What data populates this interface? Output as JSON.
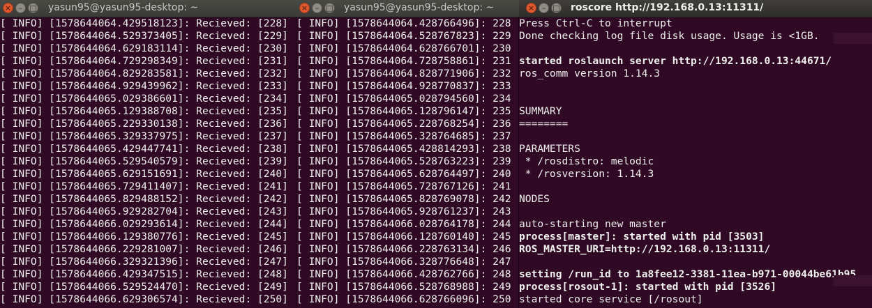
{
  "windows": [
    {
      "title": "yasun95@yasun95-desktop: ~",
      "lines": [
        "[ INFO] [1578644064.429518123]: Recieved: [228]",
        "[ INFO] [1578644064.529373405]: Recieved: [229]",
        "[ INFO] [1578644064.629183114]: Recieved: [230]",
        "[ INFO] [1578644064.729298349]: Recieved: [231]",
        "[ INFO] [1578644064.829283581]: Recieved: [232]",
        "[ INFO] [1578644064.929439962]: Recieved: [233]",
        "[ INFO] [1578644065.029386601]: Recieved: [234]",
        "[ INFO] [1578644065.129388708]: Recieved: [235]",
        "[ INFO] [1578644065.229330138]: Recieved: [236]",
        "[ INFO] [1578644065.329337975]: Recieved: [237]",
        "[ INFO] [1578644065.429447741]: Recieved: [238]",
        "[ INFO] [1578644065.529540579]: Recieved: [239]",
        "[ INFO] [1578644065.629151691]: Recieved: [240]",
        "[ INFO] [1578644065.729411407]: Recieved: [241]",
        "[ INFO] [1578644065.829488152]: Recieved: [242]",
        "[ INFO] [1578644065.929282704]: Recieved: [243]",
        "[ INFO] [1578644066.029293614]: Recieved: [244]",
        "[ INFO] [1578644066.129380776]: Recieved: [245]",
        "[ INFO] [1578644066.229281007]: Recieved: [246]",
        "[ INFO] [1578644066.329321396]: Recieved: [247]",
        "[ INFO] [1578644066.429347515]: Recieved: [248]",
        "[ INFO] [1578644066.529524470]: Recieved: [249]",
        "[ INFO] [1578644066.629306574]: Recieved: [250]"
      ]
    },
    {
      "title": "yasun95@yasun95-desktop: ~",
      "lines": [
        "[ INFO] [1578644064.428766496]: 228",
        "[ INFO] [1578644064.528767823]: 229",
        "[ INFO] [1578644064.628766701]: 230",
        "[ INFO] [1578644064.728758861]: 231",
        "[ INFO] [1578644064.828771906]: 232",
        "[ INFO] [1578644064.928770837]: 233",
        "[ INFO] [1578644065.028794560]: 234",
        "[ INFO] [1578644065.128796147]: 235",
        "[ INFO] [1578644065.228768254]: 236",
        "[ INFO] [1578644065.328764685]: 237",
        "[ INFO] [1578644065.428814293]: 238",
        "[ INFO] [1578644065.528763223]: 239",
        "[ INFO] [1578644065.628764497]: 240",
        "[ INFO] [1578644065.728767126]: 241",
        "[ INFO] [1578644065.828769078]: 242",
        "[ INFO] [1578644065.928761237]: 243",
        "[ INFO] [1578644066.028764178]: 244",
        "[ INFO] [1578644066.128760140]: 245",
        "[ INFO] [1578644066.228763134]: 246",
        "[ INFO] [1578644066.328776648]: 247",
        "[ INFO] [1578644066.428762766]: 248",
        "[ INFO] [1578644066.528768988]: 249",
        "[ INFO] [1578644066.628766096]: 250"
      ]
    },
    {
      "title": "roscore http://192.168.0.13:11311/",
      "lines": [
        {
          "text": "Press Ctrl-C to interrupt",
          "bold": false
        },
        {
          "text": "Done checking log file disk usage. Usage is <1GB.",
          "bold": false
        },
        {
          "text": "",
          "bold": false
        },
        {
          "text": "started roslaunch server http://192.168.0.13:44671/",
          "bold": true
        },
        {
          "text": "ros_comm version 1.14.3",
          "bold": false
        },
        {
          "text": "",
          "bold": false
        },
        {
          "text": "",
          "bold": false
        },
        {
          "text": "SUMMARY",
          "bold": false
        },
        {
          "text": "========",
          "bold": false
        },
        {
          "text": "",
          "bold": false
        },
        {
          "text": "PARAMETERS",
          "bold": false
        },
        {
          "text": " * /rosdistro: melodic",
          "bold": false
        },
        {
          "text": " * /rosversion: 1.14.3",
          "bold": false
        },
        {
          "text": "",
          "bold": false
        },
        {
          "text": "NODES",
          "bold": false
        },
        {
          "text": "",
          "bold": false
        },
        {
          "text": "auto-starting new master",
          "bold": false
        },
        {
          "text": "process[master]: started with pid [3503]",
          "bold": true
        },
        {
          "text": "ROS_MASTER_URI=http://192.168.0.13:11311/",
          "bold": true
        },
        {
          "text": "",
          "bold": false
        },
        {
          "text": "setting /run_id to 1a8fee12-3381-11ea-b971-00044be61b95",
          "bold": true
        },
        {
          "text": "process[rosout-1]: started with pid [3526]",
          "bold": true
        },
        {
          "text": "started core service [/rosout]",
          "bold": false
        }
      ]
    }
  ],
  "buttons": {
    "close": "×",
    "minimize": "–",
    "maximize": "□"
  }
}
